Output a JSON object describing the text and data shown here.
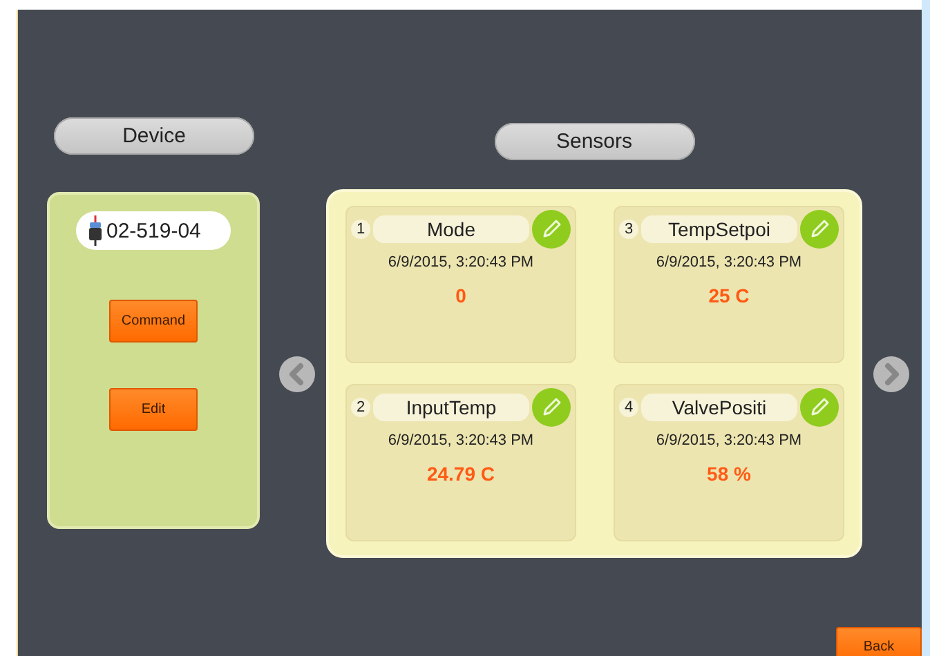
{
  "device": {
    "heading": "Device",
    "id": "02-519-04",
    "buttons": [
      "Command",
      "Edit"
    ]
  },
  "sensors": {
    "heading": "Sensors",
    "cards": [
      {
        "number": "1",
        "name": "Mode",
        "time": "6/9/2015, 3:20:43 PM",
        "value": "0"
      },
      {
        "number": "3",
        "name": "TempSetpoi",
        "time": "6/9/2015, 3:20:43 PM",
        "value": "25 C"
      },
      {
        "number": "2",
        "name": "InputTemp",
        "time": "6/9/2015, 3:20:43 PM",
        "value": "24.79 C"
      },
      {
        "number": "4",
        "name": "ValvePositi",
        "time": "6/9/2015, 3:20:43 PM",
        "value": "58 %"
      }
    ]
  },
  "back_button": "Back"
}
